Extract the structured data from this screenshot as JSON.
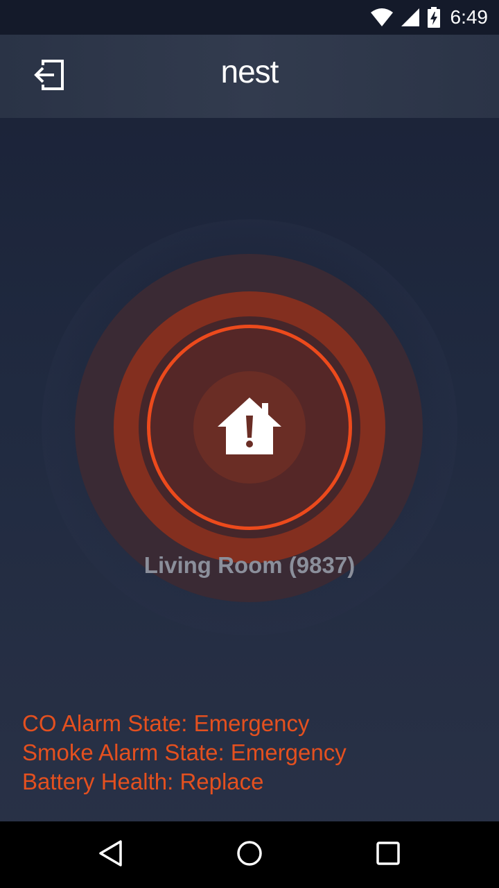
{
  "status_bar": {
    "time": "6:49",
    "icons": [
      "wifi-icon",
      "cell-signal-icon",
      "battery-charging-icon"
    ]
  },
  "app_bar": {
    "logo_text": "nest",
    "exit_icon": "exit-icon"
  },
  "alarm": {
    "icon": "house-alert-icon",
    "room_label": "Living Room (9837)"
  },
  "status": {
    "co_state": "CO Alarm State: Emergency",
    "smoke_state": "Smoke Alarm State: Emergency",
    "battery_health": "Battery Health: Replace"
  },
  "nav_bar": {
    "icons": [
      "back-icon",
      "home-icon",
      "recents-icon"
    ]
  },
  "colors": {
    "alert_orange": "#e4501f",
    "ring_line": "#ec4a1c",
    "background": "#1a2136"
  }
}
